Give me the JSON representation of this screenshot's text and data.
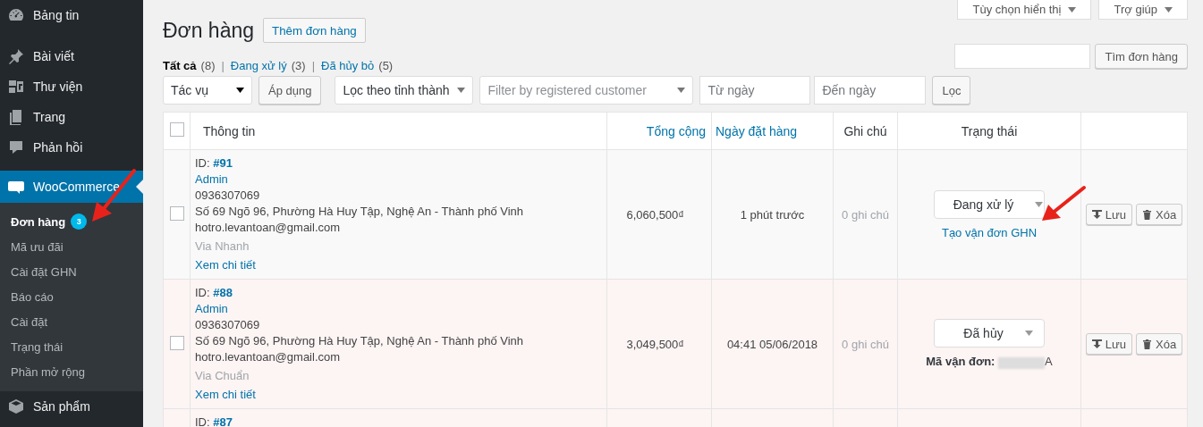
{
  "menu": {
    "items": [
      {
        "label": "Bảng tin",
        "selected": false
      },
      {
        "label": "Bài viết",
        "selected": false
      },
      {
        "label": "Thư viện",
        "selected": false
      },
      {
        "label": "Trang",
        "selected": false
      },
      {
        "label": "Phản hồi",
        "selected": false
      },
      {
        "label": "WooCommerce",
        "selected": true,
        "children": [
          {
            "label": "Đơn hàng",
            "selected": true,
            "badge": "3"
          },
          {
            "label": "Mã ưu đãi",
            "selected": false
          },
          {
            "label": "Cài đặt GHN",
            "selected": false
          },
          {
            "label": "Báo cáo",
            "selected": false
          },
          {
            "label": "Cài đặt",
            "selected": false
          },
          {
            "label": "Trạng thái",
            "selected": false
          },
          {
            "label": "Phần mở rộng",
            "selected": false
          }
        ]
      },
      {
        "label": "Sản phẩm",
        "selected": false
      }
    ]
  },
  "screen_options": [
    {
      "label": "Tùy chọn hiển thị"
    },
    {
      "label": "Trợ giúp"
    }
  ],
  "page_title": "Đơn hàng",
  "add_button": "Thêm đơn hàng",
  "views": [
    {
      "label": "Tất cả",
      "count": "(8)",
      "selected": true,
      "separator": "|"
    },
    {
      "label": "Đang xử lý",
      "count": "(3)",
      "selected": false,
      "separator": "|"
    },
    {
      "label": "Đã hủy bỏ",
      "count": "(5)",
      "selected": false
    }
  ],
  "search": {
    "button": "Tìm đơn hàng"
  },
  "filters": {
    "bulk_action": "Tác vụ",
    "apply": "Áp dụng",
    "province": "Lọc theo tỉnh thành",
    "customer_placeholder": "Filter by registered customer",
    "from_placeholder": "Từ ngày",
    "to_placeholder": "Đến ngày",
    "filter_button": "Lọc"
  },
  "table": {
    "select_all_checked": false,
    "columns": [
      {
        "label": "Thông tin",
        "sortable": false
      },
      {
        "label": "Tổng cộng",
        "sortable": true
      },
      {
        "label": "Ngày đặt hàng",
        "sortable": true
      },
      {
        "label": "Ghi chú",
        "sortable": false
      },
      {
        "label": "Trạng thái",
        "sortable": false
      }
    ],
    "rows": [
      {
        "kind": "processing",
        "checked": false,
        "id_label": "ID:",
        "id": "#91",
        "name": "Admin",
        "phone": "0936307069",
        "address": "Số 69 Ngõ 96, Phường Hà Huy Tập, Nghệ An - Thành phố Vinh",
        "email": "hotro.levantoan@gmail.com",
        "shipping": "Via Nhanh",
        "details": "Xem chi tiết",
        "total": "6,060,500₫",
        "date": "1 phút trước",
        "notes": "0 ghi chú",
        "status": "Đang xử lý",
        "action_link": "Tạo vận đơn GHN",
        "save": "Lưu",
        "delete": "Xóa"
      },
      {
        "kind": "cancelled",
        "checked": false,
        "id_label": "ID:",
        "id": "#88",
        "name": "Admin",
        "phone": "0936307069",
        "address": "Số 69 Ngõ 96, Phường Hà Huy Tập, Nghệ An - Thành phố Vinh",
        "email": "hotro.levantoan@gmail.com",
        "shipping": "Via Chuẩn",
        "details": "Xem chi tiết",
        "total": "3,049,500₫",
        "date": "04:41 05/06/2018",
        "notes": "0 ghi chú",
        "status": "Đã hủy",
        "tracking_label": "Mã vận đơn:",
        "tracking_suffix": "A",
        "save": "Lưu",
        "delete": "Xóa"
      },
      {
        "kind": "cancelled",
        "id_label": "ID:",
        "id": "#87"
      }
    ]
  }
}
